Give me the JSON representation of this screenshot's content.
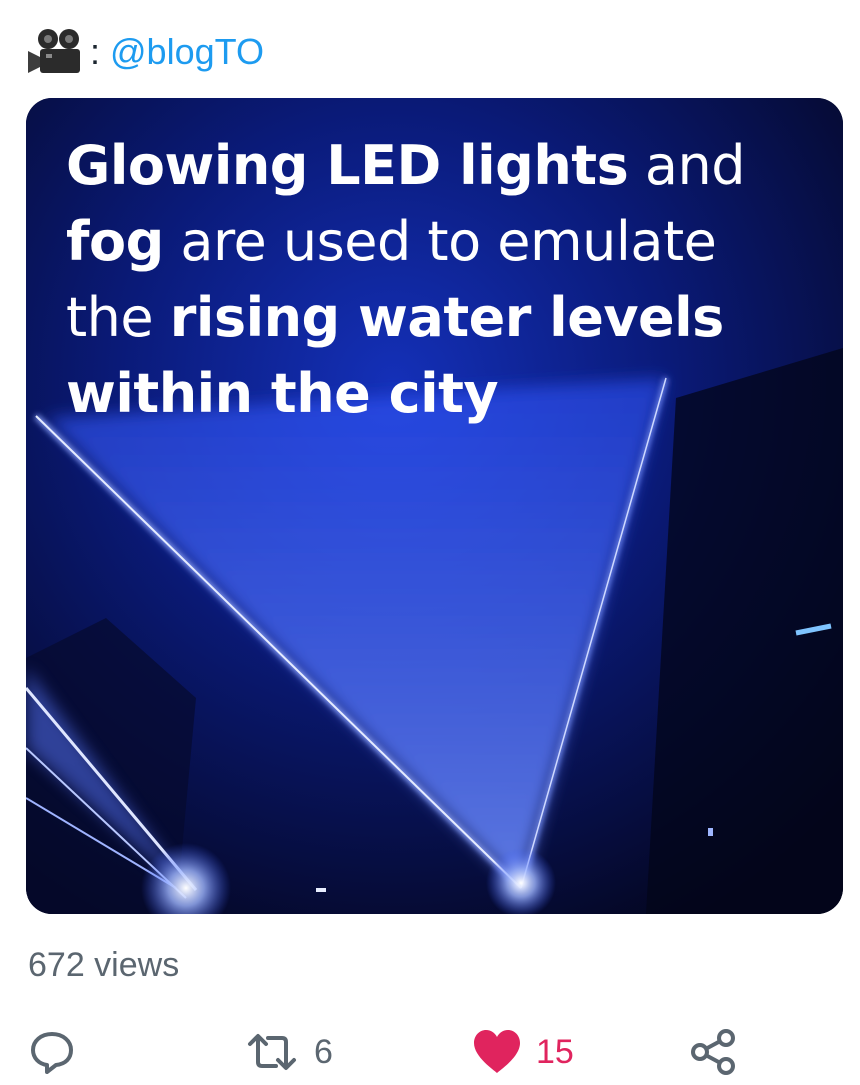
{
  "credit": {
    "icon": "movie-camera-icon",
    "colon": ":",
    "handle": "@blogTO"
  },
  "media": {
    "caption_lines": [
      [
        {
          "text": "Glowing LED lights",
          "bold": true
        },
        {
          "text": " and",
          "bold": false
        }
      ],
      [
        {
          "text": "fog",
          "bold": true
        },
        {
          "text": " are used to emulate",
          "bold": false
        }
      ],
      [
        {
          "text": "the ",
          "bold": false
        },
        {
          "text": "rising water levels",
          "bold": true
        }
      ],
      [
        {
          "text": "within the city",
          "bold": true
        }
      ]
    ]
  },
  "stats": {
    "views": "672 views"
  },
  "actions": {
    "reply": {
      "icon": "reply-icon"
    },
    "retweet": {
      "icon": "retweet-icon",
      "count": "6"
    },
    "like": {
      "icon": "heart-icon",
      "count": "15",
      "active": true
    },
    "share": {
      "icon": "share-icon"
    }
  },
  "colors": {
    "link": "#1d9bf0",
    "muted": "#5b6670",
    "like": "#e0245e",
    "laser": "#3a5cff"
  }
}
